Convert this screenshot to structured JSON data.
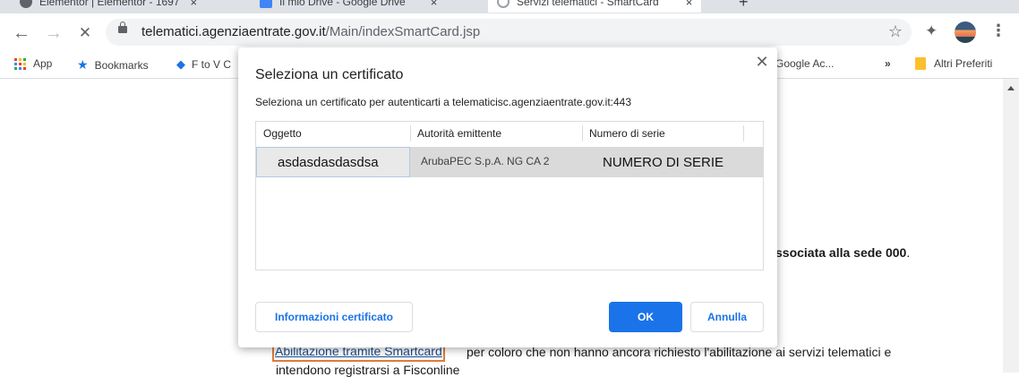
{
  "browser": {
    "tabs": [
      {
        "title": "Elementor | Elementor - 1697",
        "favicon_color": "#5f6368"
      },
      {
        "title": "Il mio Drive - Google Drive",
        "favicon_color": "#4285f4"
      },
      {
        "title": "Servizi telematici - SmartCard",
        "favicon_color": "#9aa0a6"
      }
    ],
    "new_tab_symbol": "+",
    "tab_close_symbol": "×",
    "url_host": "telematici.agenziaentrate.gov.it",
    "url_path": "/Main/indexSmartCard.jsp",
    "nav": {
      "back": "←",
      "forward": "→",
      "reload": "✕"
    },
    "icons": {
      "star": "☆",
      "extensions": "✦",
      "menu": "⋮"
    }
  },
  "bookmarks": {
    "apps_label": "App",
    "bookmarks_label": "Bookmarks",
    "f_to_v_label": "F to V C",
    "google_ac_label": "Google Ac...",
    "overflow_label": "»",
    "other_label": "Altri Preferiti",
    "colors": {
      "star": "#1a73e8",
      "diamond": "#1a73e8",
      "folder": "#fbc02d"
    }
  },
  "page": {
    "fragment1": "ssociata alla sede 000",
    "fragment1_tail": ".",
    "link_text": "Abilitazione tramite Smartcard",
    "line1_rest": " per coloro che non hanno ancora richiesto l'abilitazione ai servizi telematici e",
    "line2": "intendono registrarsi a Fisconline"
  },
  "dialog": {
    "title": "Seleziona un certificato",
    "close": "✕",
    "subtitle": "Seleziona un certificato per autenticarti a telematicisc.agenziaentrate.gov.it:443",
    "columns": [
      "Oggetto",
      "Autorità emittente",
      "Numero di serie"
    ],
    "rows": [
      {
        "subject": "asdasdasdasdsa",
        "issuer": "ArubaPEC S.p.A. NG CA 2",
        "serial": "NUMERO DI SERIE"
      }
    ],
    "buttons": {
      "info": "Informazioni certificato",
      "ok": "OK",
      "cancel": "Annulla"
    },
    "colors": {
      "primary": "#1a73e8"
    }
  }
}
